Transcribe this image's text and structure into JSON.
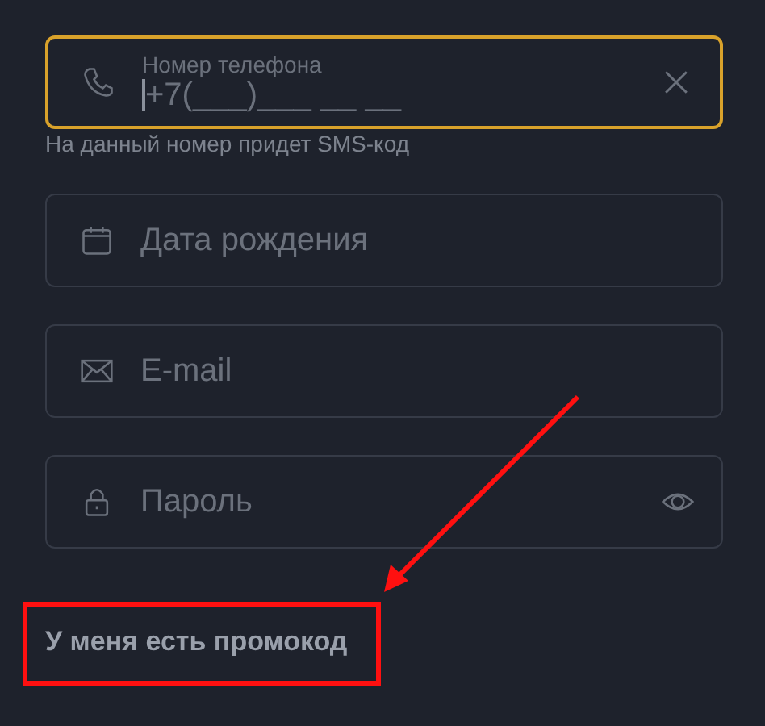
{
  "fields": [
    {
      "kind": "phone",
      "label": "Номер телефона",
      "value": "+7(___)___ __ __",
      "focused": true,
      "clearable": true,
      "hint": "На данный номер придет SMS-код"
    },
    {
      "kind": "calendar",
      "placeholder": "Дата рождения",
      "focused": false
    },
    {
      "kind": "mail",
      "placeholder": "E-mail",
      "focused": false
    },
    {
      "kind": "lock",
      "placeholder": "Пароль",
      "focused": false,
      "password_toggle": true
    }
  ],
  "promo_link": "У меня есть промокод"
}
